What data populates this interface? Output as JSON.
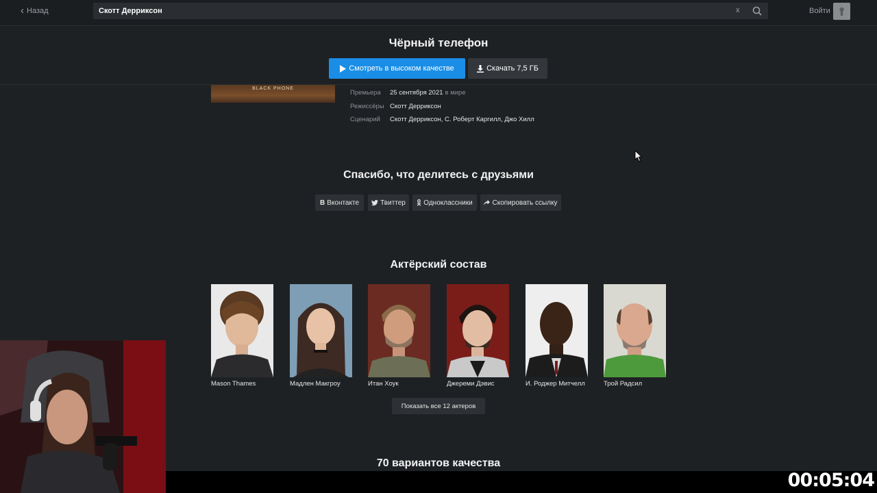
{
  "header": {
    "back_label": "Назад",
    "search_value": "Скотт Дерриксон",
    "clear_label": "x",
    "login_label": "Войти"
  },
  "movie": {
    "title": "Чёрный телефон",
    "watch_label": "Смотреть в высоком качестве",
    "download_label": "Скачать 7,5 ГБ",
    "poster_text": "BLACK PHONE"
  },
  "info": [
    {
      "label": "Премьера",
      "value": "25 сентября 2021",
      "suffix": "в мире"
    },
    {
      "label": "Режиссёры",
      "value": "Скотт Дерриксон",
      "suffix": ""
    },
    {
      "label": "Сценарий",
      "value": "Скотт Дерриксон, С. Роберт Каргилл, Джо Хилл",
      "suffix": ""
    }
  ],
  "share": {
    "title": "Спасибо, что делитесь с друзьями",
    "buttons": [
      {
        "label": "Вконтакте",
        "icon": "vk-icon"
      },
      {
        "label": "Твиттер",
        "icon": "twitter-icon"
      },
      {
        "label": "Одноклассники",
        "icon": "odnoklassniki-icon"
      },
      {
        "label": "Скопировать ссылку",
        "icon": "share-arrow-icon"
      }
    ]
  },
  "cast": {
    "title": "Актёрский состав",
    "actors": [
      {
        "name": "Mason Thames"
      },
      {
        "name": "Мадлен Макгроу"
      },
      {
        "name": "Итан Хоук"
      },
      {
        "name": "Джереми Дэвис"
      },
      {
        "name": "И. Роджер Митчелл"
      },
      {
        "name": "Трой Радсил"
      }
    ],
    "show_all_label": "Показать все 12 актеров"
  },
  "quality": {
    "title": "70 вариантов качества"
  },
  "stream": {
    "timer": "00:05:04"
  },
  "colors": {
    "accent": "#1a8ee6",
    "background": "#1e2124"
  }
}
